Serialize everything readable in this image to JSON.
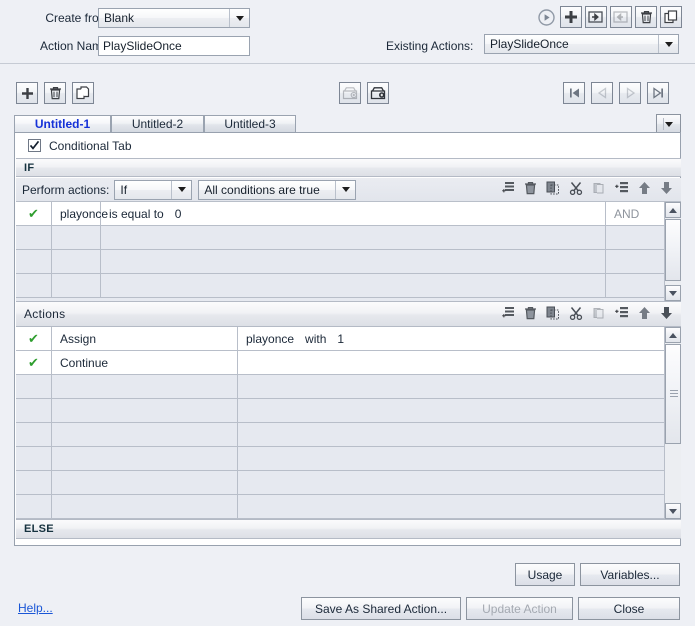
{
  "top": {
    "create_from_label": "Create from:",
    "create_from_value": "Blank",
    "action_name_label": "Action Name:",
    "action_name_value": "PlaySlideOnce",
    "existing_actions_label": "Existing Actions:",
    "existing_actions_value": "PlaySlideOnce",
    "icons": [
      "play-icon",
      "add-icon",
      "import-icon",
      "export-icon",
      "delete-icon",
      "duplicate-icon"
    ]
  },
  "toolbar": {
    "left_icons": [
      "add-tab-icon",
      "delete-tab-icon",
      "copy-tab-icon"
    ],
    "mid_icons": [
      "import-tab-icon",
      "export-tab-icon"
    ],
    "nav_icons": [
      "first-icon",
      "previous-icon",
      "next-icon",
      "last-icon"
    ]
  },
  "tabs": {
    "items": [
      {
        "label": "Untitled-1",
        "active": true
      },
      {
        "label": "Untitled-2",
        "active": false
      },
      {
        "label": "Untitled-3",
        "active": false
      }
    ],
    "menu_icon": "tab-menu-icon"
  },
  "panel": {
    "conditional_tab_label": "Conditional Tab",
    "conditional_tab_checked": true,
    "if_label": "IF",
    "else_label": "ELSE",
    "perform_actions_label": "Perform actions:",
    "perform_mode": "If",
    "perform_condition": "All conditions are true",
    "grid_tool_icons": [
      "add-row-icon",
      "delete-row-icon",
      "copy-icon",
      "cut-icon",
      "paste-icon",
      "insert-row-icon",
      "move-up-icon",
      "move-down-icon"
    ],
    "conditions": {
      "rows": [
        {
          "enabled": true,
          "variable": "playonce",
          "operator": "is equal to",
          "value": "0",
          "conjunction": "AND"
        }
      ],
      "empty_row_count": 3
    },
    "actions_label": "Actions",
    "actions": {
      "rows": [
        {
          "enabled": true,
          "name": "Assign",
          "target": "playonce",
          "keyword": "with",
          "value": "1"
        },
        {
          "enabled": true,
          "name": "Continue",
          "target": "",
          "keyword": "",
          "value": ""
        }
      ],
      "empty_row_count": 6
    }
  },
  "footer": {
    "usage_label": "Usage",
    "variables_label": "Variables...",
    "help_label": "Help...",
    "save_shared_label": "Save As Shared Action...",
    "update_label": "Update Action",
    "update_enabled": false,
    "close_label": "Close"
  },
  "colors": {
    "background": "#eef0f5",
    "accent_tab": "#1531d8",
    "link": "#1a56d6",
    "check_green": "#2f9e2f",
    "grid_empty": "#e6e9f0"
  }
}
